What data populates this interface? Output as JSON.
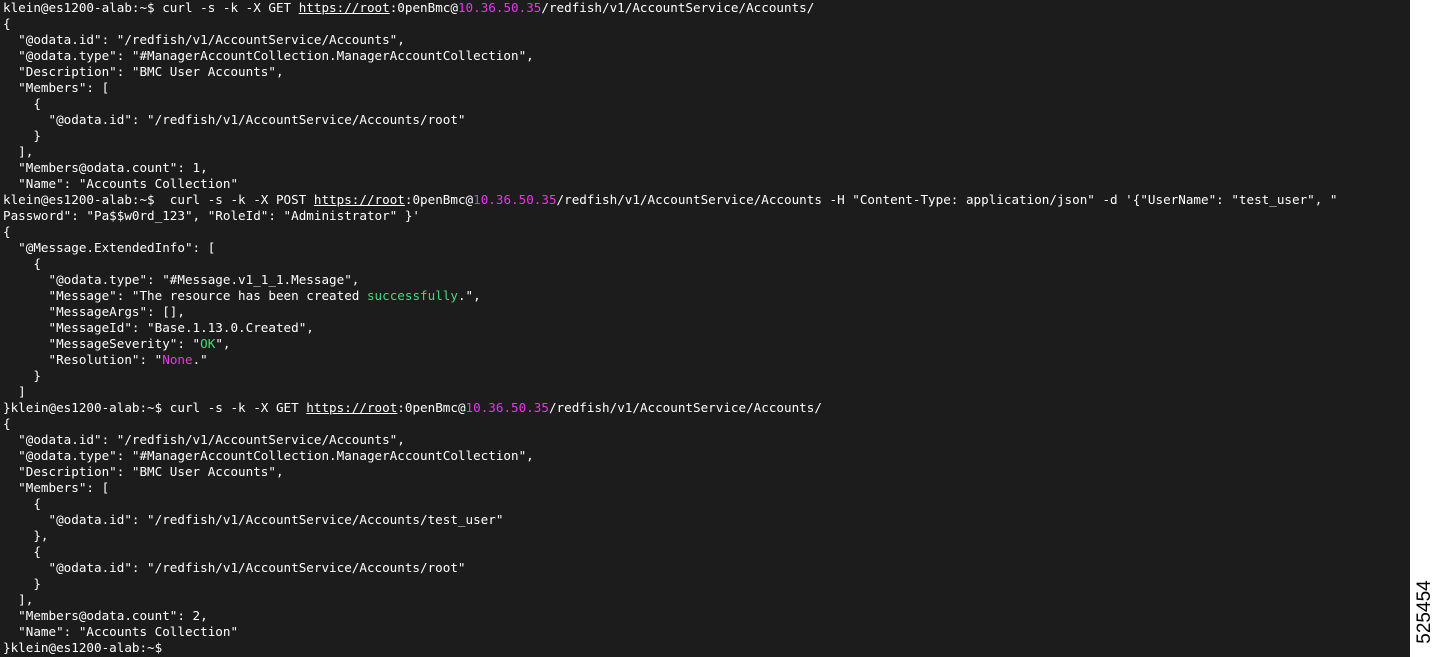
{
  "terminal": {
    "colors": {
      "background": "#1c1c1c",
      "text": "#ffffff",
      "ip_address": "#e935e9",
      "highlight_green": "#3fdc7a",
      "highlight_magenta": "#e935e9"
    },
    "lines": [
      [
        {
          "t": "klein@es1200-alab:~$ curl -s -k -X GET "
        },
        {
          "t": "https://root",
          "s": "u"
        },
        {
          "t": ":0penBmc@"
        },
        {
          "t": "10.36.50.35",
          "s": "mag"
        },
        {
          "t": "/redfish/v1/AccountService/Accounts/"
        }
      ],
      [
        {
          "t": "{"
        }
      ],
      [
        {
          "t": "  \"@odata.id\": \"/redfish/v1/AccountService/Accounts\","
        }
      ],
      [
        {
          "t": "  \"@odata.type\": \"#ManagerAccountCollection.ManagerAccountCollection\","
        }
      ],
      [
        {
          "t": "  \"Description\": \"BMC User Accounts\","
        }
      ],
      [
        {
          "t": "  \"Members\": ["
        }
      ],
      [
        {
          "t": "    {"
        }
      ],
      [
        {
          "t": "      \"@odata.id\": \"/redfish/v1/AccountService/Accounts/root\""
        }
      ],
      [
        {
          "t": "    }"
        }
      ],
      [
        {
          "t": "  ],"
        }
      ],
      [
        {
          "t": "  \"Members@odata.count\": 1,"
        }
      ],
      [
        {
          "t": "  \"Name\": \"Accounts Collection\""
        }
      ],
      [
        {
          "t": "klein@es1200-alab:~$  curl -s -k -X POST "
        },
        {
          "t": "https://root",
          "s": "u"
        },
        {
          "t": ":0penBmc@"
        },
        {
          "t": "10.36.50.35",
          "s": "mag"
        },
        {
          "t": "/redfish/v1/AccountService/Accounts -H \"Content-Type: application/json\" -d '{\"UserName\": \"test_user\", \""
        }
      ],
      [
        {
          "t": "Password\": \"Pa$$w0rd_123\", \"RoleId\": \"Administrator\" }'"
        }
      ],
      [
        {
          "t": "{"
        }
      ],
      [
        {
          "t": "  \"@Message.ExtendedInfo\": ["
        }
      ],
      [
        {
          "t": "    {"
        }
      ],
      [
        {
          "t": "      \"@odata.type\": \"#Message.v1_1_1.Message\","
        }
      ],
      [
        {
          "t": "      \"Message\": \"The resource has been created "
        },
        {
          "t": "successfully",
          "s": "grn"
        },
        {
          "t": ".\","
        }
      ],
      [
        {
          "t": "      \"MessageArgs\": [],"
        }
      ],
      [
        {
          "t": "      \"MessageId\": \"Base.1.13.0.Created\","
        }
      ],
      [
        {
          "t": "      \"MessageSeverity\": \""
        },
        {
          "t": "OK",
          "s": "grn"
        },
        {
          "t": "\","
        }
      ],
      [
        {
          "t": "      \"Resolution\": \""
        },
        {
          "t": "None",
          "s": "mag"
        },
        {
          "t": ".\""
        }
      ],
      [
        {
          "t": "    }"
        }
      ],
      [
        {
          "t": "  ]"
        }
      ],
      [
        {
          "t": "}klein@es1200-alab:~$ curl -s -k -X GET "
        },
        {
          "t": "https://root",
          "s": "u"
        },
        {
          "t": ":0penBmc@"
        },
        {
          "t": "10.36.50.35",
          "s": "mag"
        },
        {
          "t": "/redfish/v1/AccountService/Accounts/"
        }
      ],
      [
        {
          "t": "{"
        }
      ],
      [
        {
          "t": "  \"@odata.id\": \"/redfish/v1/AccountService/Accounts\","
        }
      ],
      [
        {
          "t": "  \"@odata.type\": \"#ManagerAccountCollection.ManagerAccountCollection\","
        }
      ],
      [
        {
          "t": "  \"Description\": \"BMC User Accounts\","
        }
      ],
      [
        {
          "t": "  \"Members\": ["
        }
      ],
      [
        {
          "t": "    {"
        }
      ],
      [
        {
          "t": "      \"@odata.id\": \"/redfish/v1/AccountService/Accounts/test_user\""
        }
      ],
      [
        {
          "t": "    },"
        }
      ],
      [
        {
          "t": "    {"
        }
      ],
      [
        {
          "t": "      \"@odata.id\": \"/redfish/v1/AccountService/Accounts/root\""
        }
      ],
      [
        {
          "t": "    }"
        }
      ],
      [
        {
          "t": "  ],"
        }
      ],
      [
        {
          "t": "  \"Members@odata.count\": 2,"
        }
      ],
      [
        {
          "t": "  \"Name\": \"Accounts Collection\""
        }
      ],
      [
        {
          "t": "}klein@es1200-alab:~$"
        }
      ]
    ]
  },
  "figure_id": "525454"
}
